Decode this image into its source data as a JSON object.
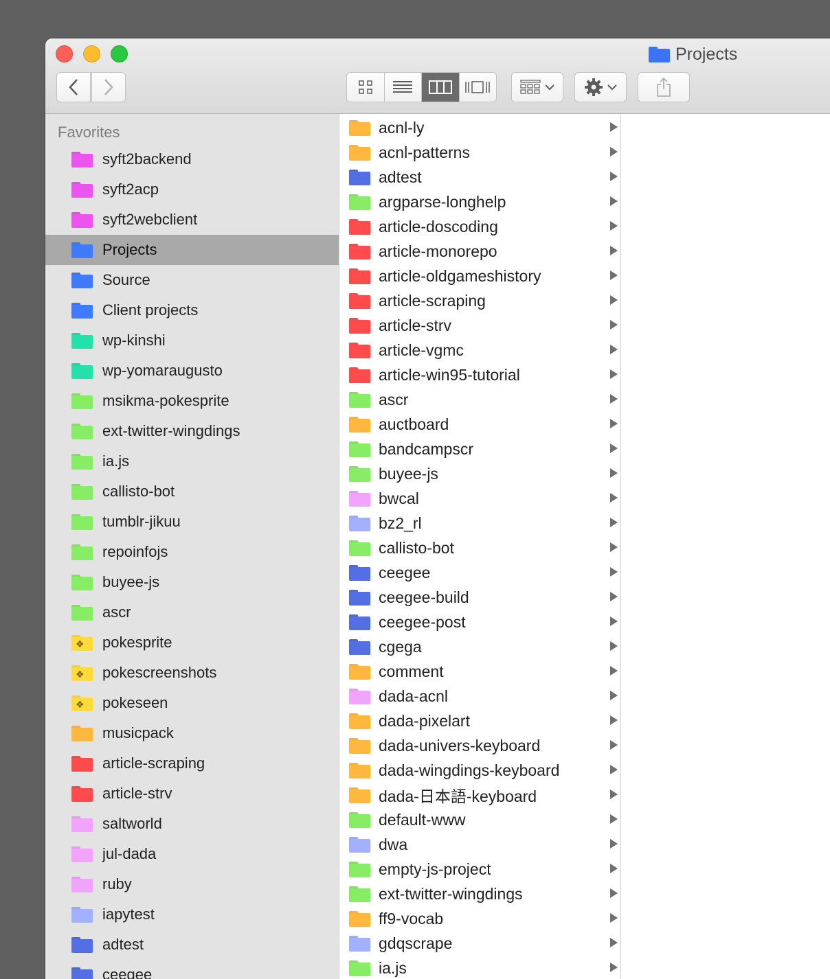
{
  "colors": {
    "magenta": "#df4fe0",
    "blue": "#3b73f4",
    "teal": "#22d3a0",
    "green": "#7ee05e",
    "yellow": "#f4cf36",
    "orange": "#fdae3a",
    "red": "#fb4747",
    "lavender": "#e39af0",
    "periwinkle": "#9aa6f6",
    "navy": "#4f68d6"
  },
  "window": {
    "title": "Projects",
    "title_icon": "folder-icon"
  },
  "toolbar": {
    "back_icon": "chevron-left-icon",
    "forward_icon": "chevron-right-icon",
    "view_modes": [
      "icon-view",
      "list-view",
      "column-view",
      "cover-flow-view"
    ],
    "active_view": "column-view",
    "group_icon": "group-by-icon",
    "action_icon": "gear-icon",
    "share_icon": "share-icon"
  },
  "sidebar": {
    "section_label": "Favorites",
    "items": [
      {
        "label": "syft2backend",
        "color": "magenta"
      },
      {
        "label": "syft2acp",
        "color": "magenta"
      },
      {
        "label": "syft2webclient",
        "color": "magenta"
      },
      {
        "label": "Projects",
        "color": "blue",
        "selected": true
      },
      {
        "label": "Source",
        "color": "blue"
      },
      {
        "label": "Client projects",
        "color": "blue"
      },
      {
        "label": "wp-kinshi",
        "color": "teal"
      },
      {
        "label": "wp-yomaraugusto",
        "color": "teal"
      },
      {
        "label": "msikma-pokesprite",
        "color": "green"
      },
      {
        "label": "ext-twitter-wingdings",
        "color": "green"
      },
      {
        "label": "ia.js",
        "color": "green"
      },
      {
        "label": "callisto-bot",
        "color": "green"
      },
      {
        "label": "tumblr-jikuu",
        "color": "green"
      },
      {
        "label": "repoinfojs",
        "color": "green"
      },
      {
        "label": "buyee-js",
        "color": "green"
      },
      {
        "label": "ascr",
        "color": "green"
      },
      {
        "label": "pokesprite",
        "color": "yellow",
        "emblem": true
      },
      {
        "label": "pokescreenshots",
        "color": "yellow",
        "emblem": true
      },
      {
        "label": "pokeseen",
        "color": "yellow",
        "emblem": true
      },
      {
        "label": "musicpack",
        "color": "orange"
      },
      {
        "label": "article-scraping",
        "color": "red"
      },
      {
        "label": "article-strv",
        "color": "red"
      },
      {
        "label": "saltworld",
        "color": "lavender"
      },
      {
        "label": "jul-dada",
        "color": "lavender"
      },
      {
        "label": "ruby",
        "color": "lavender"
      },
      {
        "label": "iapytest",
        "color": "periwinkle"
      },
      {
        "label": "adtest",
        "color": "navy"
      },
      {
        "label": "ceegee",
        "color": "navy"
      }
    ]
  },
  "column": {
    "items": [
      {
        "label": "acnl-ly",
        "color": "orange"
      },
      {
        "label": "acnl-patterns",
        "color": "orange"
      },
      {
        "label": "adtest",
        "color": "navy"
      },
      {
        "label": "argparse-longhelp",
        "color": "green"
      },
      {
        "label": "article-doscoding",
        "color": "red"
      },
      {
        "label": "article-monorepo",
        "color": "red"
      },
      {
        "label": "article-oldgameshistory",
        "color": "red"
      },
      {
        "label": "article-scraping",
        "color": "red"
      },
      {
        "label": "article-strv",
        "color": "red"
      },
      {
        "label": "article-vgmc",
        "color": "red"
      },
      {
        "label": "article-win95-tutorial",
        "color": "red"
      },
      {
        "label": "ascr",
        "color": "green"
      },
      {
        "label": "auctboard",
        "color": "orange"
      },
      {
        "label": "bandcampscr",
        "color": "green"
      },
      {
        "label": "buyee-js",
        "color": "green"
      },
      {
        "label": "bwcal",
        "color": "lavender"
      },
      {
        "label": "bz2_rl",
        "color": "periwinkle"
      },
      {
        "label": "callisto-bot",
        "color": "green"
      },
      {
        "label": "ceegee",
        "color": "navy"
      },
      {
        "label": "ceegee-build",
        "color": "navy"
      },
      {
        "label": "ceegee-post",
        "color": "navy"
      },
      {
        "label": "cgega",
        "color": "navy"
      },
      {
        "label": "comment",
        "color": "orange"
      },
      {
        "label": "dada-acnl",
        "color": "lavender"
      },
      {
        "label": "dada-pixelart",
        "color": "orange"
      },
      {
        "label": "dada-univers-keyboard",
        "color": "orange"
      },
      {
        "label": "dada-wingdings-keyboard",
        "color": "orange"
      },
      {
        "label": "dada-日本語-keyboard",
        "color": "orange"
      },
      {
        "label": "default-www",
        "color": "green"
      },
      {
        "label": "dwa",
        "color": "periwinkle"
      },
      {
        "label": "empty-js-project",
        "color": "green"
      },
      {
        "label": "ext-twitter-wingdings",
        "color": "green"
      },
      {
        "label": "ff9-vocab",
        "color": "orange"
      },
      {
        "label": "gdqscrape",
        "color": "periwinkle"
      },
      {
        "label": "ia.js",
        "color": "green"
      }
    ]
  }
}
